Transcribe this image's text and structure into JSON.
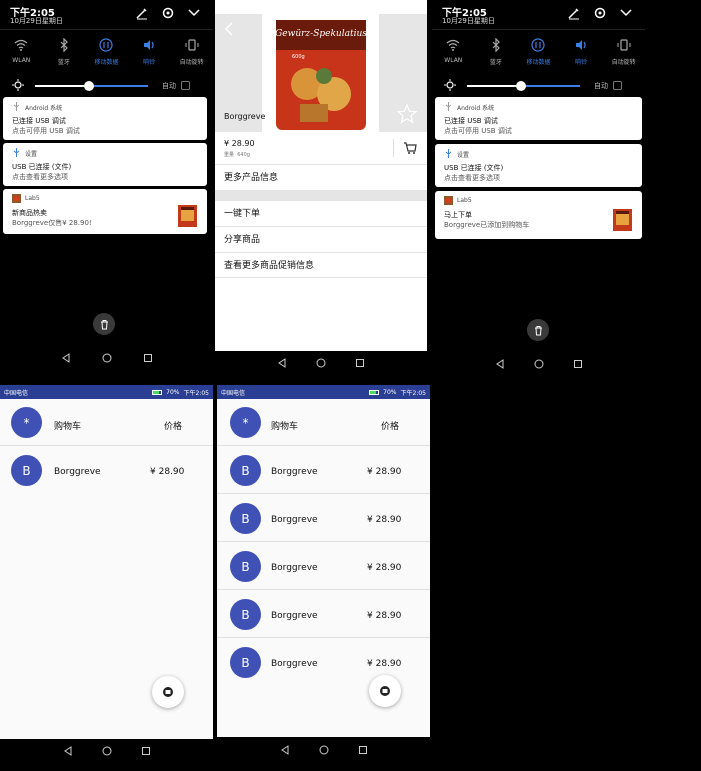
{
  "shade": {
    "time": "下午2:05",
    "date": "10月29日星期日",
    "quick_settings": [
      {
        "label": "WLAN",
        "icon": "wifi-icon",
        "on": false
      },
      {
        "label": "蓝牙",
        "icon": "bluetooth-icon",
        "on": false
      },
      {
        "label": "移动数据",
        "icon": "mobile-data-icon",
        "on": true
      },
      {
        "label": "响铃",
        "icon": "volume-icon",
        "on": true
      },
      {
        "label": "自动旋转",
        "icon": "rotate-icon",
        "on": false
      }
    ],
    "brightness": 0.35,
    "auto_label": "自动"
  },
  "notifications_left": [
    {
      "app": "Android 系统",
      "title": "已连接 USB 调试",
      "text": "点击可停用 USB 调试"
    },
    {
      "app": "设置",
      "title": "USB 已连接 (文件)",
      "text": "点击查看更多选项"
    },
    {
      "app": "Lab5",
      "title": "新商品热卖",
      "text": "Borggreve仅售¥ 28.90!"
    }
  ],
  "notifications_right": [
    {
      "app": "Android 系统",
      "title": "已连接 USB 调试",
      "text": "点击可停用 USB 调试"
    },
    {
      "app": "设置",
      "title": "USB 已连接 (文件)",
      "text": "点击查看更多选项"
    },
    {
      "app": "Lab5",
      "title": "马上下单",
      "text": "Borggreve已添加到购物车"
    }
  ],
  "status": {
    "carrier": "中国电信",
    "battery": "70%",
    "time": "下午2:05"
  },
  "product": {
    "name": "Borggreve",
    "price": "¥ 28.90",
    "weight_label": "重量",
    "weight": "640g",
    "more_info": "更多产品信息",
    "actions": [
      "一键下单",
      "分享商品",
      "查看更多商品促销信息"
    ],
    "package_text": "Gewürz-Spekulatius",
    "package_weight": "600g"
  },
  "cart": {
    "header_avatar": "*",
    "header_title": "购物车",
    "header_price": "价格",
    "left_items": [
      {
        "initial": "B",
        "name": "Borggreve",
        "price": "¥ 28.90"
      }
    ],
    "right_items": [
      {
        "initial": "B",
        "name": "Borggreve",
        "price": "¥ 28.90"
      },
      {
        "initial": "B",
        "name": "Borggreve",
        "price": "¥ 28.90"
      },
      {
        "initial": "B",
        "name": "Borggreve",
        "price": "¥ 28.90"
      },
      {
        "initial": "B",
        "name": "Borggreve",
        "price": "¥ 28.90"
      },
      {
        "initial": "B",
        "name": "Borggreve",
        "price": "¥ 28.90"
      }
    ]
  },
  "colors": {
    "primary": "#3f51b5",
    "statusbar": "#2a3f94",
    "accent": "#3b7fe6"
  }
}
